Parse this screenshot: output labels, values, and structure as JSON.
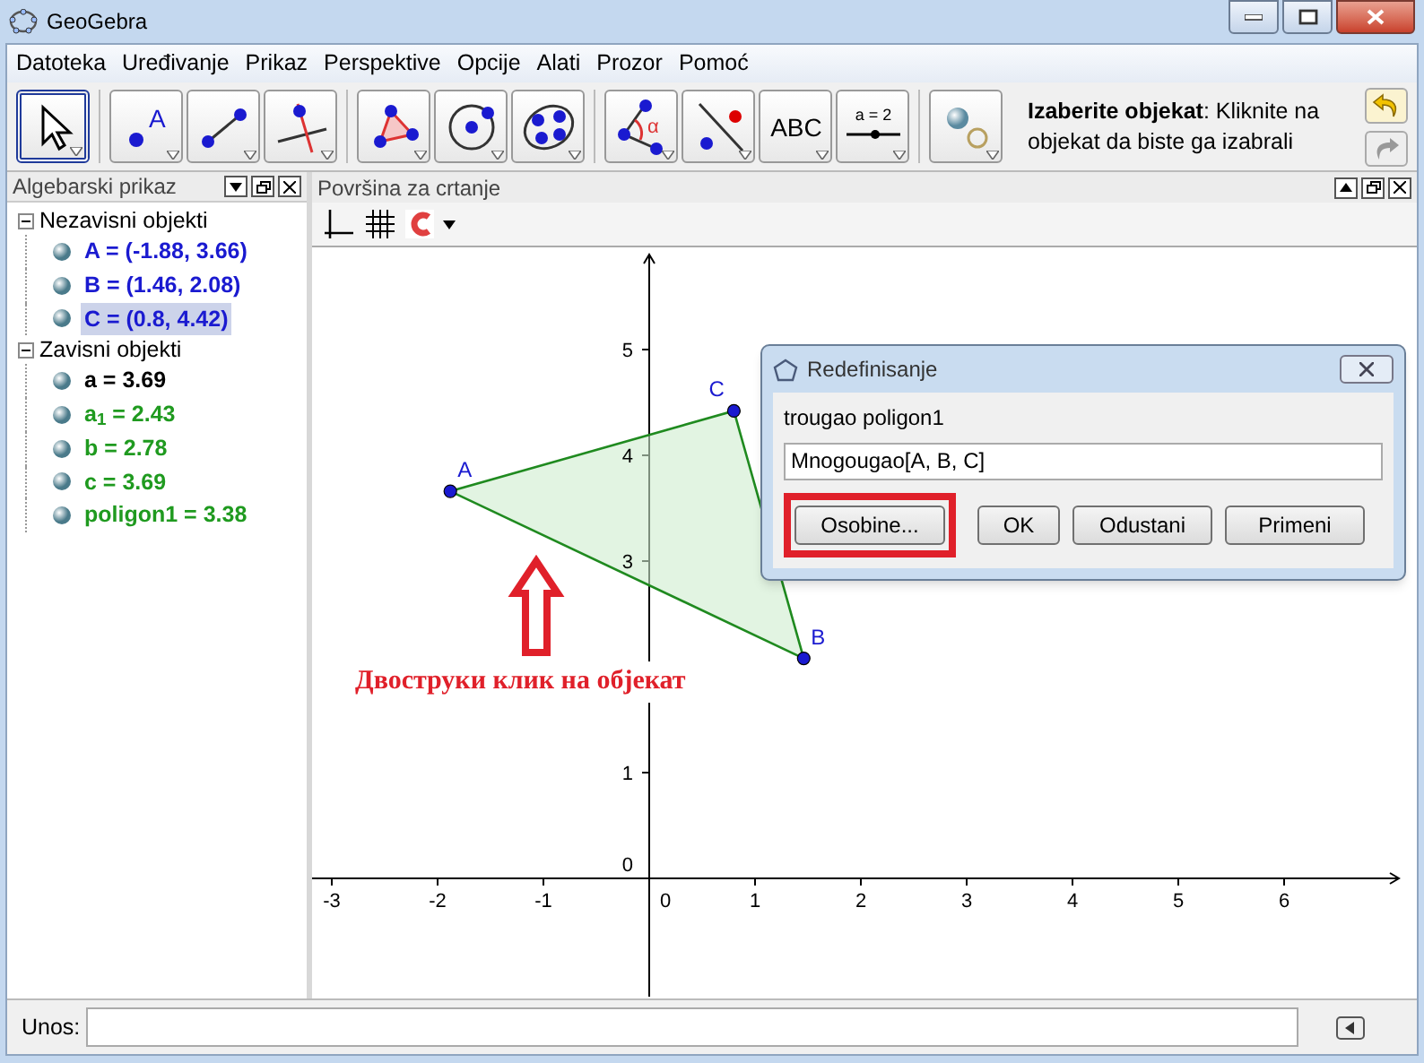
{
  "window": {
    "title": "GeoGebra"
  },
  "menu": [
    "Datoteka",
    "Uređivanje",
    "Prikaz",
    "Perspektive",
    "Opcije",
    "Alati",
    "Prozor",
    "Pomoć"
  ],
  "tool_groups": [
    [
      {
        "kind": "move",
        "selected": true
      }
    ],
    [
      {
        "kind": "point",
        "selected": false,
        "label": "A"
      },
      {
        "kind": "segment",
        "selected": false
      },
      {
        "kind": "perpendicular",
        "selected": false
      }
    ],
    [
      {
        "kind": "polygon",
        "selected": false
      },
      {
        "kind": "circle",
        "selected": false
      },
      {
        "kind": "conic",
        "selected": false
      }
    ],
    [
      {
        "kind": "angle",
        "selected": false,
        "label": "α"
      },
      {
        "kind": "reflect",
        "selected": false
      },
      {
        "kind": "text",
        "selected": false,
        "label": "ABC"
      },
      {
        "kind": "slider",
        "selected": false,
        "label": "a = 2"
      }
    ],
    [
      {
        "kind": "showhide",
        "selected": false
      }
    ]
  ],
  "help": "**Izaberite objekat**: Kliknite na objekat da biste ga izabrali",
  "algebra_view": {
    "title": "Algebarski prikaz",
    "groups": [
      {
        "label": "Nezavisni objekti",
        "expanded": true,
        "children": [
          {
            "text": "A = (-1.88, 3.66)",
            "color": "#1a1ad0",
            "selected": false
          },
          {
            "text": "B = (1.46, 2.08)",
            "color": "#1a1ad0",
            "selected": false
          },
          {
            "text": "C = (0.8, 4.42)",
            "color": "#1a1ad0",
            "selected": true
          }
        ]
      },
      {
        "label": "Zavisni objekti",
        "expanded": true,
        "children": [
          {
            "text": "a = 3.69",
            "color": "#000000",
            "selected": false
          },
          {
            "text": "a$_{1}$ = 2.43",
            "color": "#1f9a1f",
            "selected": false
          },
          {
            "text": "b = 2.78",
            "color": "#1f9a1f",
            "selected": false
          },
          {
            "text": "c = 3.69",
            "color": "#1f9a1f",
            "selected": false
          },
          {
            "text": "poligon1 = 3.38",
            "color": "#1f9a1f",
            "selected": false
          }
        ]
      }
    ]
  },
  "graphics_view": {
    "title": "Površina za crtanje",
    "x_labels": [
      "-3",
      "-2",
      "-1",
      "0",
      "1",
      "2",
      "3",
      "4",
      "5",
      "6"
    ],
    "y_labels": [
      "5",
      "4",
      "3",
      "1",
      "0"
    ],
    "points": [
      {
        "label": "A"
      },
      {
        "label": "B"
      },
      {
        "label": "C"
      }
    ]
  },
  "annotation": {
    "text": "Двоструки клик на објекат"
  },
  "dialog": {
    "title": "Redefinisanje",
    "label": "trougao poligon1",
    "value": "Mnogougao[A, B, C]",
    "buttons": [
      {
        "label": "Osobine...",
        "highlighted": true
      },
      {
        "label": "OK",
        "highlighted": false
      },
      {
        "label": "Odustani",
        "highlighted": false
      },
      {
        "label": "Primeni",
        "highlighted": false
      }
    ]
  },
  "input_bar": {
    "label": "Unos:"
  }
}
